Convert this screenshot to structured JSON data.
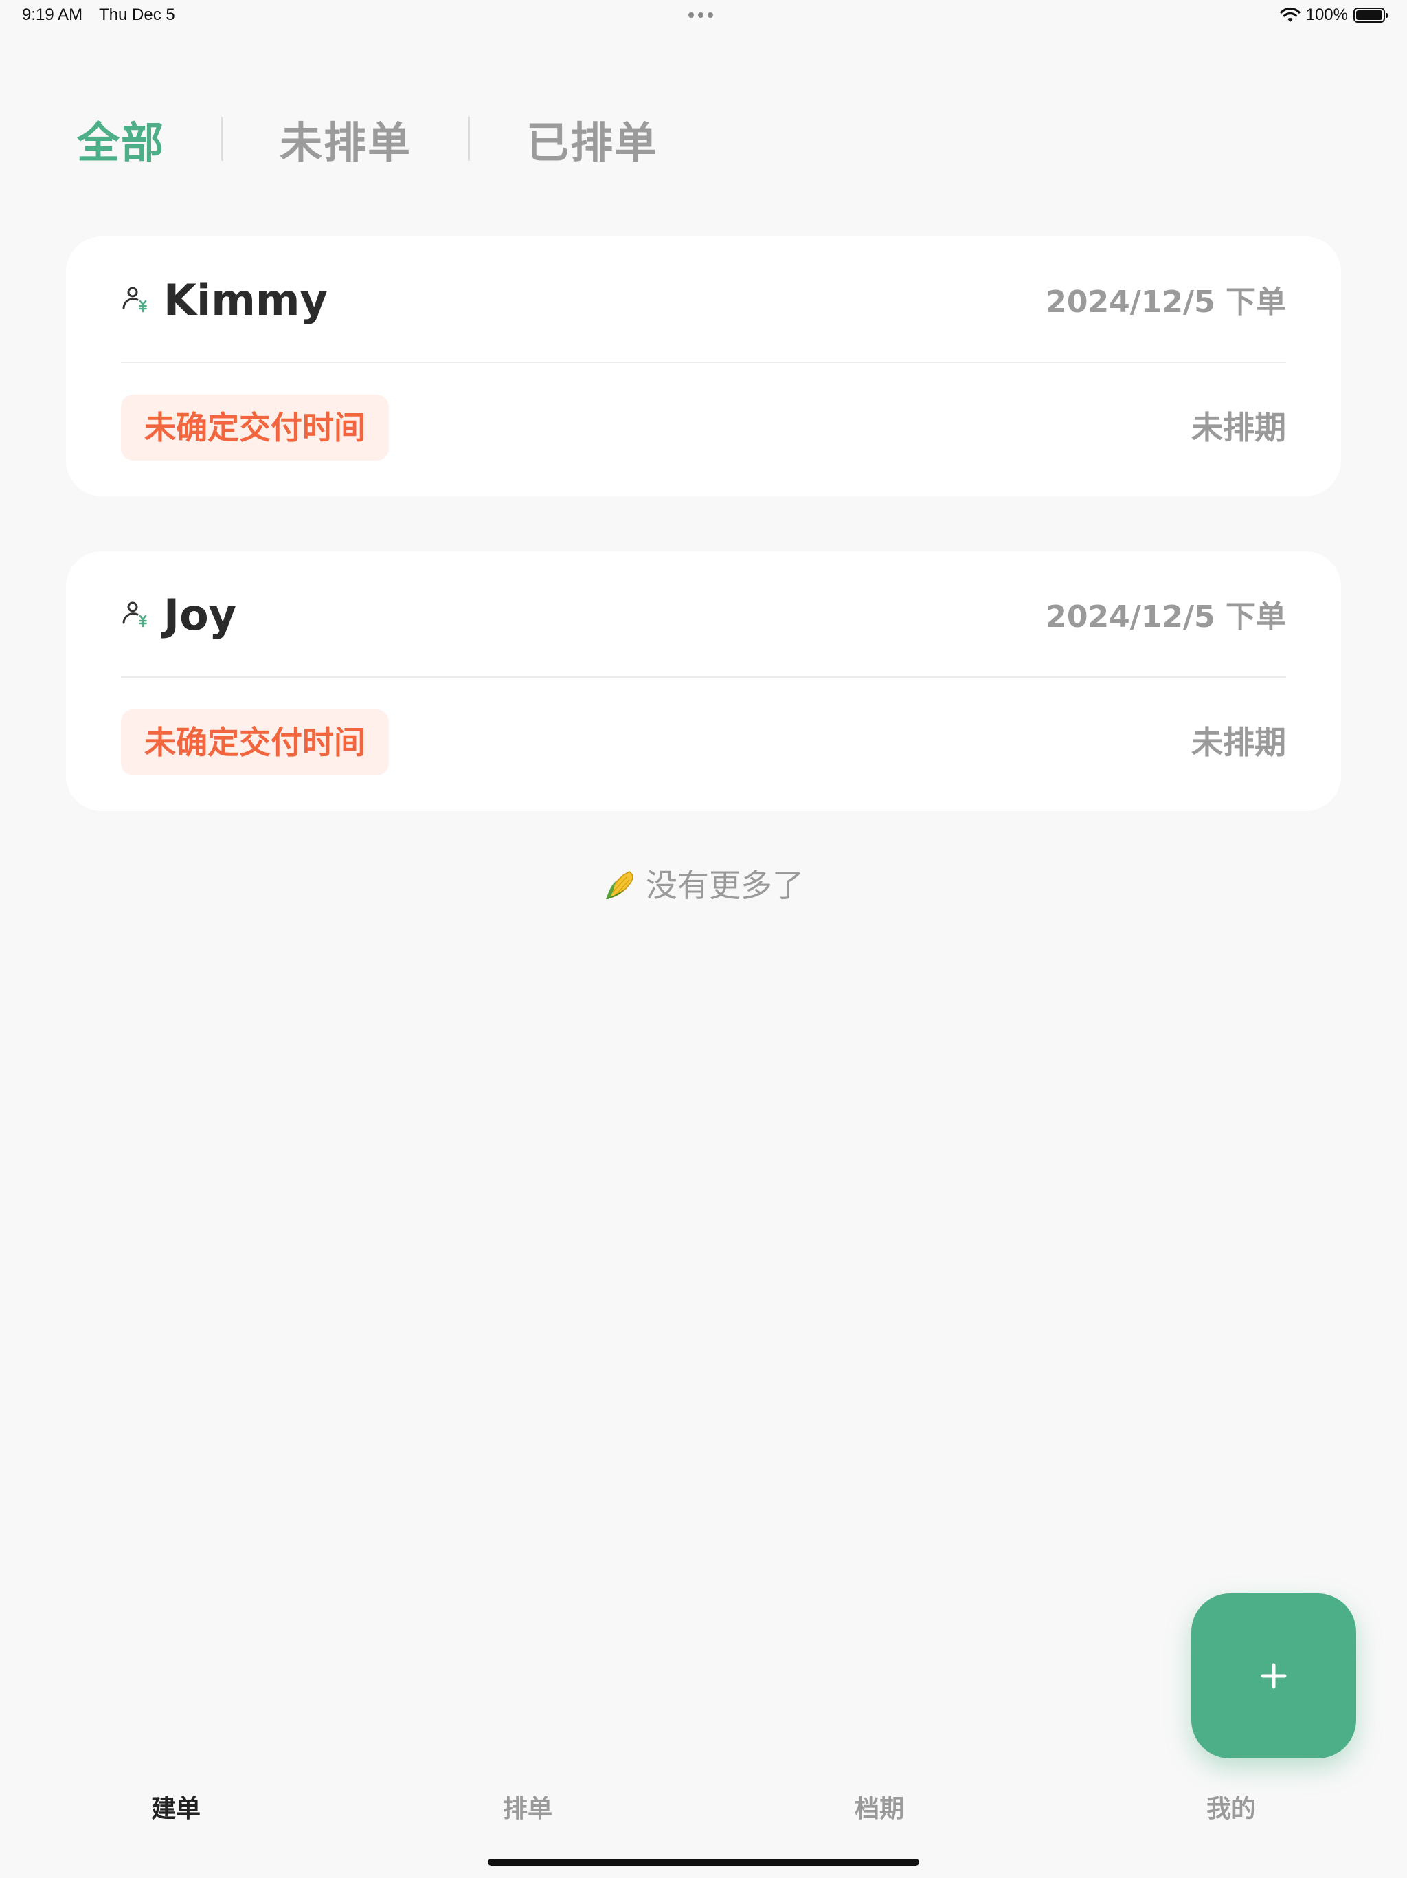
{
  "status_bar": {
    "time": "9:19 AM",
    "date": "Thu Dec 5",
    "battery": "100%",
    "wifi_icon": "wifi-icon",
    "battery_icon": "battery-full-icon"
  },
  "filter_tabs": [
    {
      "label": "全部",
      "active": true
    },
    {
      "label": "未排单",
      "active": false
    },
    {
      "label": "已排单",
      "active": false
    }
  ],
  "orders": [
    {
      "customer": "Kimmy",
      "icon": "customer-payment-icon",
      "date": "2024/12/5 下单",
      "delivery_badge": "未确定交付时间",
      "schedule_status": "未排期"
    },
    {
      "customer": "Joy",
      "icon": "customer-payment-icon",
      "date": "2024/12/5 下单",
      "delivery_badge": "未确定交付时间",
      "schedule_status": "未排期"
    }
  ],
  "list_end": {
    "icon": "corn-icon",
    "text": "没有更多了"
  },
  "fab": {
    "icon": "plus-icon"
  },
  "bottom_nav": [
    {
      "label": "建单",
      "active": true
    },
    {
      "label": "排单",
      "active": false
    },
    {
      "label": "档期",
      "active": false
    },
    {
      "label": "我的",
      "active": false
    }
  ],
  "colors": {
    "accent": "#4caf87",
    "badge_text": "#f2663f",
    "badge_bg": "#fff0ec",
    "muted_text": "#9a9a9a",
    "background": "#f8f8f8"
  }
}
